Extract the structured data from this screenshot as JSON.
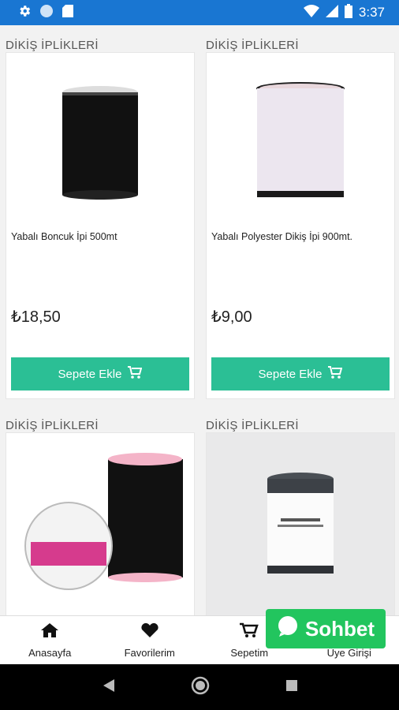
{
  "status_bar": {
    "time": "3:37",
    "icons": [
      "gear-icon",
      "circle-icon",
      "sd-card-icon",
      "wifi-icon",
      "signal-icon",
      "battery-icon"
    ]
  },
  "products": [
    {
      "category": "DİKİŞ İPLİKLERİ",
      "title": "Yabalı Boncuk İpi 500mt",
      "price": "₺18,50",
      "button": "Sepete Ekle"
    },
    {
      "category": "DİKİŞ İPLİKLERİ",
      "title": "Yabalı Polyester Dikiş İpi 900mt.",
      "price": "₺9,00",
      "button": "Sepete Ekle"
    },
    {
      "category": "DİKİŞ İPLİKLERİ",
      "title": "",
      "price": "",
      "button": ""
    },
    {
      "category": "DİKİŞ İPLİKLERİ",
      "title": "",
      "price": "",
      "button": ""
    }
  ],
  "tabs": [
    {
      "label": "Anasayfa",
      "icon": "home-icon"
    },
    {
      "label": "Favorilerim",
      "icon": "heart-icon"
    },
    {
      "label": "Sepetim",
      "icon": "cart-icon"
    },
    {
      "label": "Üye Girişi",
      "icon": "user-icon"
    }
  ],
  "chat": {
    "label": "Sohbet"
  },
  "colors": {
    "status_bar": "#1976d2",
    "button": "#2bbf95",
    "chat": "#22c55e"
  }
}
